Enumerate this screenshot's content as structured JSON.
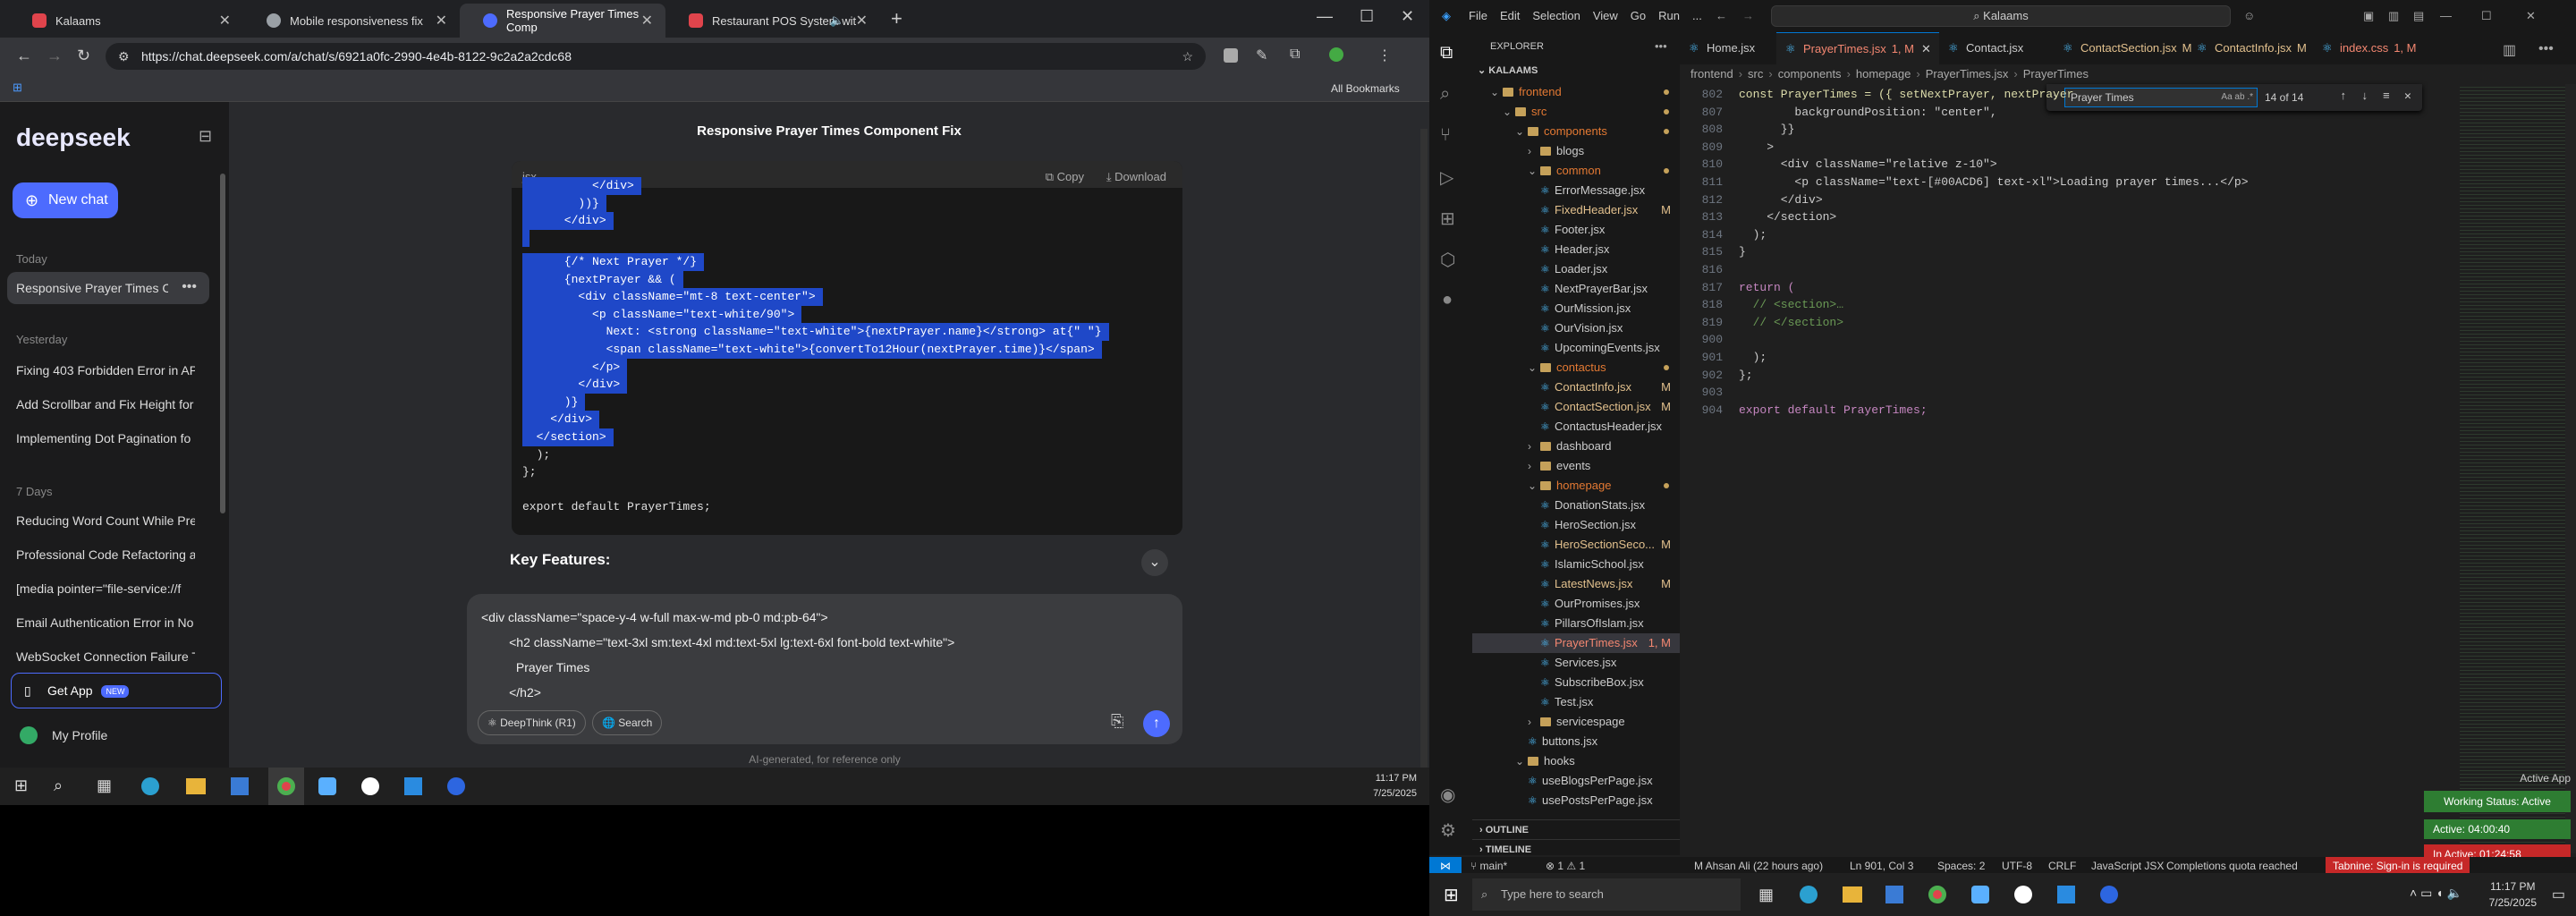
{
  "browser": {
    "tabs": [
      {
        "title": "Kalaams",
        "color": "#e0444c"
      },
      {
        "title": "Mobile responsiveness fix",
        "color": "#9aa0a6"
      },
      {
        "title": "Responsive Prayer Times Comp",
        "color": "#4d6bfe"
      },
      {
        "title": "Restaurant POS System wit",
        "color": "#e0444c"
      }
    ],
    "url": "https://chat.deepseek.com/a/chat/s/6921a0fc-2990-4e4b-8122-9c2a2a2cdc68",
    "bookmarks": "All Bookmarks"
  },
  "deepseek": {
    "logo": "deepseek",
    "new_chat": "New chat",
    "chat_title": "Responsive Prayer Times Component Fix",
    "sections": [
      {
        "label": "Today",
        "items": [
          "Responsive Prayer Times Co"
        ]
      },
      {
        "label": "Yesterday",
        "items": [
          "Fixing 403 Forbidden Error in AP",
          "Add Scrollbar and Fix Height for",
          "Implementing Dot Pagination fo"
        ]
      },
      {
        "label": "7 Days",
        "items": [
          "Reducing Word Count While Pre",
          "Professional Code Refactoring a",
          "[media pointer=\"file-service://f",
          "Email Authentication Error in No",
          "WebSocket Connection Failure T"
        ]
      }
    ],
    "get_app": "Get App",
    "new_badge": "NEW",
    "profile": "My Profile",
    "code_lang": "jsx",
    "copy": "Copy",
    "download": "Download",
    "code_selected": [
      "          </div>",
      "        ))}",
      "      </div>",
      "",
      "      {/* Next Prayer */}",
      "      {nextPrayer && (",
      "        <div className=\"mt-8 text-center\">",
      "          <p className=\"text-white/90\">",
      "            Next: <strong className=\"text-white\">{nextPrayer.name}</strong> at{\" \"}",
      "            <span className=\"text-white\">{convertTo12Hour(nextPrayer.time)}</span>",
      "          </p>",
      "        </div>",
      "      )}",
      "    </div>",
      "  </section>"
    ],
    "code_plain": [
      "  );",
      "};",
      "",
      "export default PrayerTimes;"
    ],
    "key_features": "Key Features:",
    "input_lines": [
      "<div className=\"space-y-4 w-full max-w-md pb-0 md:pb-64\">",
      "        <h2 className=\"text-3xl sm:text-4xl md:text-5xl lg:text-6xl font-bold text-white\">",
      "          Prayer Times",
      "        </h2>"
    ],
    "deepthink": "DeepThink (R1)",
    "search": "Search",
    "disclaimer": "AI-generated, for reference only"
  },
  "taskbar_left": {
    "time": "11:17 PM",
    "date": "7/25/2025"
  },
  "vscode": {
    "menu": [
      "File",
      "Edit",
      "Selection",
      "View",
      "Go",
      "Run",
      "..."
    ],
    "search": "Kalaams",
    "explorer_title": "EXPLORER",
    "root": "KALAAMS",
    "tree": [
      {
        "name": "frontend",
        "type": "folder",
        "depth": 1,
        "open": true,
        "color": "#e37933"
      },
      {
        "name": "src",
        "type": "folder",
        "depth": 2,
        "open": true,
        "color": "#e37933"
      },
      {
        "name": "components",
        "type": "folder",
        "depth": 3,
        "open": true,
        "color": "#e37933"
      },
      {
        "name": "blogs",
        "type": "folder",
        "depth": 4,
        "open": false,
        "color": "#ccc"
      },
      {
        "name": "common",
        "type": "folder",
        "depth": 4,
        "open": true,
        "color": "#e37933"
      },
      {
        "name": "ErrorMessage.jsx",
        "type": "file",
        "depth": 5,
        "color": "#ccc"
      },
      {
        "name": "FixedHeader.jsx",
        "type": "file",
        "depth": 5,
        "color": "#e2c08d",
        "badge": "M"
      },
      {
        "name": "Footer.jsx",
        "type": "file",
        "depth": 5,
        "color": "#ccc"
      },
      {
        "name": "Header.jsx",
        "type": "file",
        "depth": 5,
        "color": "#ccc"
      },
      {
        "name": "Loader.jsx",
        "type": "file",
        "depth": 5,
        "color": "#ccc"
      },
      {
        "name": "NextPrayerBar.jsx",
        "type": "file",
        "depth": 5,
        "color": "#ccc"
      },
      {
        "name": "OurMission.jsx",
        "type": "file",
        "depth": 5,
        "color": "#ccc"
      },
      {
        "name": "OurVision.jsx",
        "type": "file",
        "depth": 5,
        "color": "#ccc"
      },
      {
        "name": "UpcomingEvents.jsx",
        "type": "file",
        "depth": 5,
        "color": "#ccc"
      },
      {
        "name": "contactus",
        "type": "folder",
        "depth": 4,
        "open": true,
        "color": "#e37933"
      },
      {
        "name": "ContactInfo.jsx",
        "type": "file",
        "depth": 5,
        "color": "#e2c08d",
        "badge": "M"
      },
      {
        "name": "ContactSection.jsx",
        "type": "file",
        "depth": 5,
        "color": "#e2c08d",
        "badge": "M"
      },
      {
        "name": "ContactusHeader.jsx",
        "type": "file",
        "depth": 5,
        "color": "#ccc"
      },
      {
        "name": "dashboard",
        "type": "folder",
        "depth": 4,
        "open": false,
        "color": "#ccc"
      },
      {
        "name": "events",
        "type": "folder",
        "depth": 4,
        "open": false,
        "color": "#ccc"
      },
      {
        "name": "homepage",
        "type": "folder",
        "depth": 4,
        "open": true,
        "color": "#e37933"
      },
      {
        "name": "DonationStats.jsx",
        "type": "file",
        "depth": 5,
        "color": "#ccc"
      },
      {
        "name": "HeroSection.jsx",
        "type": "file",
        "depth": 5,
        "color": "#ccc"
      },
      {
        "name": "HeroSectionSeco...",
        "type": "file",
        "depth": 5,
        "color": "#e2c08d",
        "badge": "M"
      },
      {
        "name": "IslamicSchool.jsx",
        "type": "file",
        "depth": 5,
        "color": "#ccc"
      },
      {
        "name": "LatestNews.jsx",
        "type": "file",
        "depth": 5,
        "color": "#e2c08d",
        "badge": "M"
      },
      {
        "name": "OurPromises.jsx",
        "type": "file",
        "depth": 5,
        "color": "#ccc"
      },
      {
        "name": "PillarsOfIslam.jsx",
        "type": "file",
        "depth": 5,
        "color": "#ccc"
      },
      {
        "name": "PrayerTimes.jsx",
        "type": "file",
        "depth": 5,
        "color": "#f48771",
        "badge": "1, M",
        "selected": true
      },
      {
        "name": "Services.jsx",
        "type": "file",
        "depth": 5,
        "color": "#ccc"
      },
      {
        "name": "SubscribeBox.jsx",
        "type": "file",
        "depth": 5,
        "color": "#ccc"
      },
      {
        "name": "Test.jsx",
        "type": "file",
        "depth": 5,
        "color": "#ccc"
      },
      {
        "name": "servicespage",
        "type": "folder",
        "depth": 4,
        "open": false,
        "color": "#ccc"
      },
      {
        "name": "buttons.jsx",
        "type": "file",
        "depth": 4,
        "color": "#ccc"
      },
      {
        "name": "hooks",
        "type": "folder",
        "depth": 3,
        "open": true,
        "color": "#ccc"
      },
      {
        "name": "useBlogsPerPage.jsx",
        "type": "file",
        "depth": 4,
        "color": "#ccc"
      },
      {
        "name": "usePostsPerPage.jsx",
        "type": "file",
        "depth": 4,
        "color": "#ccc"
      }
    ],
    "outline": "OUTLINE",
    "timeline": "TIMELINE",
    "editor_tabs": [
      {
        "name": "Home.jsx",
        "badge": "",
        "color": "#ccc"
      },
      {
        "name": "PrayerTimes.jsx",
        "badge": "1, M",
        "color": "#f48771",
        "active": true
      },
      {
        "name": "Contact.jsx",
        "badge": "",
        "color": "#ccc"
      },
      {
        "name": "ContactSection.jsx",
        "badge": "M",
        "color": "#e2c08d"
      },
      {
        "name": "ContactInfo.jsx",
        "badge": "M",
        "color": "#e2c08d"
      },
      {
        "name": "index.css",
        "badge": "1, M",
        "color": "#f48771"
      }
    ],
    "breadcrumb": [
      "frontend",
      "src",
      "components",
      "homepage",
      "PrayerTimes.jsx",
      "PrayerTimes"
    ],
    "find": {
      "query": "Prayer Times",
      "result": "14 of 14"
    },
    "code_lines": [
      {
        "n": "802",
        "t": "const PrayerTimes = ({ setNextPrayer, nextPrayer"
      },
      {
        "n": "807",
        "t": "        backgroundPosition: \"center\","
      },
      {
        "n": "808",
        "t": "      }}"
      },
      {
        "n": "809",
        "t": "    >"
      },
      {
        "n": "810",
        "t": "      <div className=\"relative z-10\">"
      },
      {
        "n": "811",
        "t": "        <p className=\"text-[#00ACD6] text-xl\">Loading prayer times...</p>"
      },
      {
        "n": "812",
        "t": "      </div>"
      },
      {
        "n": "813",
        "t": "    </section>"
      },
      {
        "n": "814",
        "t": "  );"
      },
      {
        "n": "815",
        "t": "}"
      },
      {
        "n": "816",
        "t": ""
      },
      {
        "n": "817",
        "t": "return ("
      },
      {
        "n": "818",
        "t": "  // <section>…"
      },
      {
        "n": "819",
        "t": "  // </section>"
      },
      {
        "n": "900",
        "t": ""
      },
      {
        "n": "901",
        "t": "  );"
      },
      {
        "n": "902",
        "t": "};"
      },
      {
        "n": "903",
        "t": ""
      },
      {
        "n": "904",
        "t": "export default PrayerTimes;"
      }
    ],
    "status": {
      "branch": "main*",
      "problems": "⊗ 1 ⚠ 1",
      "blame": "M Ahsan Ali (22 hours ago)",
      "pos": "Ln 901, Col 3",
      "spaces": "Spaces: 2",
      "enc": "UTF-8",
      "eol": "CRLF",
      "lang": "JavaScript JSX",
      "quota": "Completions quota reached",
      "tabnine": "Tabnine: Sign-in is required"
    },
    "active_app": "Active App",
    "working_status": "Working Status: Active",
    "active_time": "Active: 04:00:40",
    "inactive_time": "In Active: 01:24:58"
  },
  "taskbar_right": {
    "search": "Type here to search",
    "time": "11:17 PM",
    "date": "7/25/2025"
  }
}
